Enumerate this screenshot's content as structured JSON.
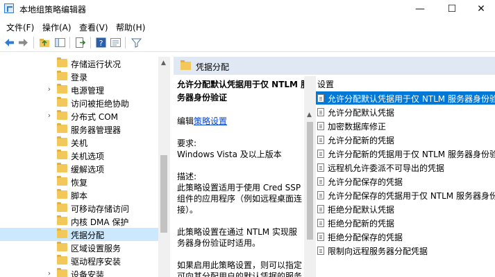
{
  "window": {
    "title": "本地组策略编辑器",
    "minimize": "—",
    "maximize": "☐",
    "close": "✕"
  },
  "menu": [
    {
      "label": "文件(F)"
    },
    {
      "label": "操作(A)"
    },
    {
      "label": "查看(V)"
    },
    {
      "label": "帮助(H)"
    }
  ],
  "toolbar_icons": [
    "back-arrow-icon",
    "forward-arrow-icon",
    "folder-up-icon",
    "show-hide-tree-icon",
    "export-list-icon",
    "help-icon",
    "properties-icon",
    "filter-icon"
  ],
  "tree": {
    "items": [
      {
        "label": "存储运行状况",
        "expander": ""
      },
      {
        "label": "登录",
        "expander": ""
      },
      {
        "label": "电源管理",
        "expander": "›"
      },
      {
        "label": "访问被拒绝协助",
        "expander": ""
      },
      {
        "label": "分布式 COM",
        "expander": "›"
      },
      {
        "label": "服务器管理器",
        "expander": ""
      },
      {
        "label": "关机",
        "expander": ""
      },
      {
        "label": "关机选项",
        "expander": ""
      },
      {
        "label": "缓解选项",
        "expander": ""
      },
      {
        "label": "恢复",
        "expander": ""
      },
      {
        "label": "脚本",
        "expander": ""
      },
      {
        "label": "可移动存储访问",
        "expander": ""
      },
      {
        "label": "内核 DMA 保护",
        "expander": ""
      },
      {
        "label": "凭据分配",
        "expander": "",
        "selected": true
      },
      {
        "label": "区域设置服务",
        "expander": ""
      },
      {
        "label": "驱动程序安装",
        "expander": ""
      },
      {
        "label": "设备安装",
        "expander": "›"
      }
    ]
  },
  "right": {
    "header": "凭据分配",
    "description": {
      "title": "允许分配默认凭据用于仅 NTLM 服务器身份验证",
      "edit_prefix": "编辑",
      "edit_link": "策略设置",
      "requirements_label": "要求:",
      "requirements_value": "Windows Vista 及以上版本",
      "desc_label": "描述:",
      "desc_lines": [
        "此策略设置适用于使用 Cred SSP",
        "组件的应用程序（例如远程桌面连",
        "接）。",
        "",
        "此策略设置在通过 NTLM 实现服",
        "务器身份验证时适用。",
        "",
        "如果启用此策略设置，则可以指定",
        "可向其分配用户的默认凭据的服务"
      ]
    },
    "settings_header": "设置",
    "settings": [
      {
        "label": "允许分配默认凭据用于仅 NTLM 服务器身份验证",
        "selected": true
      },
      {
        "label": "允许分配默认凭据"
      },
      {
        "label": "加密数据库修正"
      },
      {
        "label": "允许分配新的凭据"
      },
      {
        "label": "允许分配新的凭据用于仅 NTLM 服务器身份验证"
      },
      {
        "label": "远程机允许委派不可导出的凭据"
      },
      {
        "label": "允许分配保存的凭据"
      },
      {
        "label": "允许分配保存的凭据用于仅 NTLM 服务器身份验证"
      },
      {
        "label": "拒绝分配默认凭据"
      },
      {
        "label": "拒绝分配新的凭据"
      },
      {
        "label": "拒绝分配保存的凭据"
      },
      {
        "label": "限制向远程服务器分配凭据"
      }
    ]
  },
  "colors": {
    "accent": "#0078d7",
    "tree_selected": "#cce8ff",
    "header_bg": "#dfe8f3",
    "folder": "#f3c85a"
  }
}
